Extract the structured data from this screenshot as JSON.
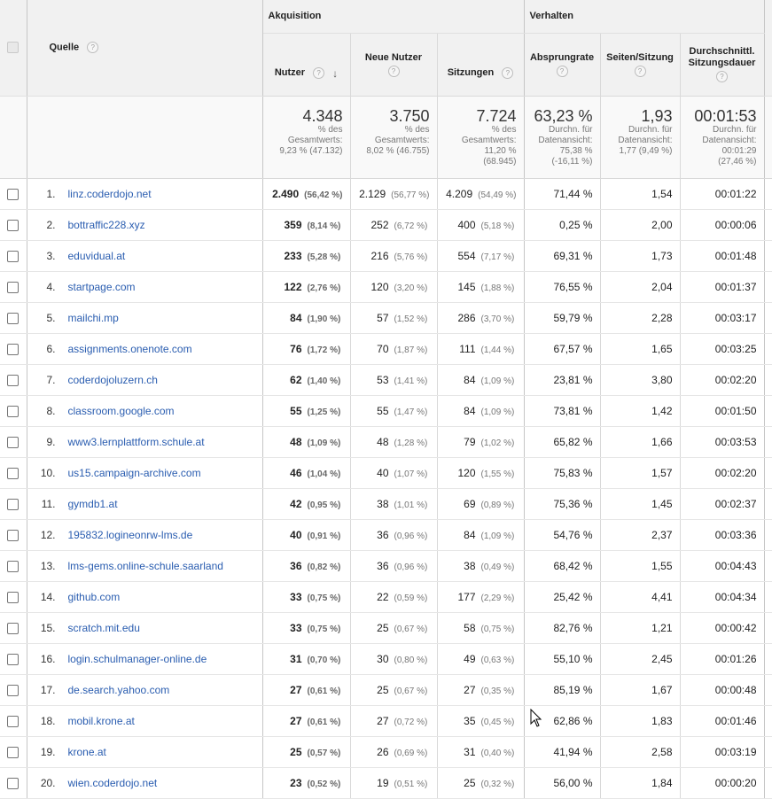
{
  "header": {
    "group_acquisition": "Akquisition",
    "group_behavior": "Verhalten",
    "col_source": "Quelle",
    "col_users": "Nutzer",
    "col_new_users": "Neue Nutzer",
    "col_sessions": "Sitzungen",
    "col_bounce": "Absprungrate",
    "col_pages": "Seiten/Sitzung",
    "col_duration_1": "Durchschnittl.",
    "col_duration_2": "Sitzungsdauer",
    "help_glyph": "?",
    "sort_glyph": "↓"
  },
  "totals": {
    "users": "4.348",
    "users_l1": "% des",
    "users_l2": "Gesamtwerts:",
    "users_l3": "9,23 % (47.132)",
    "new_users": "3.750",
    "new_users_l1": "% des",
    "new_users_l2": "Gesamtwerts:",
    "new_users_l3": "8,02 % (46.755)",
    "sessions": "7.724",
    "sessions_l1": "% des",
    "sessions_l2": "Gesamtwerts:",
    "sessions_l3": "11,20 %",
    "sessions_l4": "(68.945)",
    "bounce": "63,23 %",
    "bounce_l1": "Durchn. für",
    "bounce_l2": "Datenansicht:",
    "bounce_l3": "75,38 %",
    "bounce_l4": "(-16,11 %)",
    "pages": "1,93",
    "pages_l1": "Durchn. für",
    "pages_l2": "Datenansicht:",
    "pages_l3": "1,77 (9,49 %)",
    "duration": "00:01:53",
    "duration_l1": "Durchn. für",
    "duration_l2": "Datenansicht:",
    "duration_l3": "00:01:29",
    "duration_l4": "(27,46 %)"
  },
  "rows": [
    {
      "idx": "1.",
      "source": "linz.coderdojo.net",
      "users": "2.490",
      "users_pct": "(56,42 %)",
      "new_users": "2.129",
      "new_users_pct": "(56,77 %)",
      "sessions": "4.209",
      "sessions_pct": "(54,49 %)",
      "bounce": "71,44 %",
      "pages": "1,54",
      "duration": "00:01:22"
    },
    {
      "idx": "2.",
      "source": "bottraffic228.xyz",
      "users": "359",
      "users_pct": "(8,14 %)",
      "new_users": "252",
      "new_users_pct": "(6,72 %)",
      "sessions": "400",
      "sessions_pct": "(5,18 %)",
      "bounce": "0,25 %",
      "pages": "2,00",
      "duration": "00:00:06"
    },
    {
      "idx": "3.",
      "source": "eduvidual.at",
      "users": "233",
      "users_pct": "(5,28 %)",
      "new_users": "216",
      "new_users_pct": "(5,76 %)",
      "sessions": "554",
      "sessions_pct": "(7,17 %)",
      "bounce": "69,31 %",
      "pages": "1,73",
      "duration": "00:01:48"
    },
    {
      "idx": "4.",
      "source": "startpage.com",
      "users": "122",
      "users_pct": "(2,76 %)",
      "new_users": "120",
      "new_users_pct": "(3,20 %)",
      "sessions": "145",
      "sessions_pct": "(1,88 %)",
      "bounce": "76,55 %",
      "pages": "2,04",
      "duration": "00:01:37"
    },
    {
      "idx": "5.",
      "source": "mailchi.mp",
      "users": "84",
      "users_pct": "(1,90 %)",
      "new_users": "57",
      "new_users_pct": "(1,52 %)",
      "sessions": "286",
      "sessions_pct": "(3,70 %)",
      "bounce": "59,79 %",
      "pages": "2,28",
      "duration": "00:03:17"
    },
    {
      "idx": "6.",
      "source": "assignments.onenote.com",
      "users": "76",
      "users_pct": "(1,72 %)",
      "new_users": "70",
      "new_users_pct": "(1,87 %)",
      "sessions": "111",
      "sessions_pct": "(1,44 %)",
      "bounce": "67,57 %",
      "pages": "1,65",
      "duration": "00:03:25"
    },
    {
      "idx": "7.",
      "source": "coderdojoluzern.ch",
      "users": "62",
      "users_pct": "(1,40 %)",
      "new_users": "53",
      "new_users_pct": "(1,41 %)",
      "sessions": "84",
      "sessions_pct": "(1,09 %)",
      "bounce": "23,81 %",
      "pages": "3,80",
      "duration": "00:02:20"
    },
    {
      "idx": "8.",
      "source": "classroom.google.com",
      "users": "55",
      "users_pct": "(1,25 %)",
      "new_users": "55",
      "new_users_pct": "(1,47 %)",
      "sessions": "84",
      "sessions_pct": "(1,09 %)",
      "bounce": "73,81 %",
      "pages": "1,42",
      "duration": "00:01:50"
    },
    {
      "idx": "9.",
      "source": "www3.lernplattform.schule.at",
      "users": "48",
      "users_pct": "(1,09 %)",
      "new_users": "48",
      "new_users_pct": "(1,28 %)",
      "sessions": "79",
      "sessions_pct": "(1,02 %)",
      "bounce": "65,82 %",
      "pages": "1,66",
      "duration": "00:03:53"
    },
    {
      "idx": "10.",
      "source": "us15.campaign-archive.com",
      "users": "46",
      "users_pct": "(1,04 %)",
      "new_users": "40",
      "new_users_pct": "(1,07 %)",
      "sessions": "120",
      "sessions_pct": "(1,55 %)",
      "bounce": "75,83 %",
      "pages": "1,57",
      "duration": "00:02:20"
    },
    {
      "idx": "11.",
      "source": "gymdb1.at",
      "users": "42",
      "users_pct": "(0,95 %)",
      "new_users": "38",
      "new_users_pct": "(1,01 %)",
      "sessions": "69",
      "sessions_pct": "(0,89 %)",
      "bounce": "75,36 %",
      "pages": "1,45",
      "duration": "00:02:37"
    },
    {
      "idx": "12.",
      "source": "195832.logineonrw-lms.de",
      "users": "40",
      "users_pct": "(0,91 %)",
      "new_users": "36",
      "new_users_pct": "(0,96 %)",
      "sessions": "84",
      "sessions_pct": "(1,09 %)",
      "bounce": "54,76 %",
      "pages": "2,37",
      "duration": "00:03:36"
    },
    {
      "idx": "13.",
      "source": "lms-gems.online-schule.saarland",
      "users": "36",
      "users_pct": "(0,82 %)",
      "new_users": "36",
      "new_users_pct": "(0,96 %)",
      "sessions": "38",
      "sessions_pct": "(0,49 %)",
      "bounce": "68,42 %",
      "pages": "1,55",
      "duration": "00:04:43"
    },
    {
      "idx": "14.",
      "source": "github.com",
      "users": "33",
      "users_pct": "(0,75 %)",
      "new_users": "22",
      "new_users_pct": "(0,59 %)",
      "sessions": "177",
      "sessions_pct": "(2,29 %)",
      "bounce": "25,42 %",
      "pages": "4,41",
      "duration": "00:04:34"
    },
    {
      "idx": "15.",
      "source": "scratch.mit.edu",
      "users": "33",
      "users_pct": "(0,75 %)",
      "new_users": "25",
      "new_users_pct": "(0,67 %)",
      "sessions": "58",
      "sessions_pct": "(0,75 %)",
      "bounce": "82,76 %",
      "pages": "1,21",
      "duration": "00:00:42"
    },
    {
      "idx": "16.",
      "source": "login.schulmanager-online.de",
      "users": "31",
      "users_pct": "(0,70 %)",
      "new_users": "30",
      "new_users_pct": "(0,80 %)",
      "sessions": "49",
      "sessions_pct": "(0,63 %)",
      "bounce": "55,10 %",
      "pages": "2,45",
      "duration": "00:01:26"
    },
    {
      "idx": "17.",
      "source": "de.search.yahoo.com",
      "users": "27",
      "users_pct": "(0,61 %)",
      "new_users": "25",
      "new_users_pct": "(0,67 %)",
      "sessions": "27",
      "sessions_pct": "(0,35 %)",
      "bounce": "85,19 %",
      "pages": "1,67",
      "duration": "00:00:48"
    },
    {
      "idx": "18.",
      "source": "mobil.krone.at",
      "users": "27",
      "users_pct": "(0,61 %)",
      "new_users": "27",
      "new_users_pct": "(0,72 %)",
      "sessions": "35",
      "sessions_pct": "(0,45 %)",
      "bounce": "62,86 %",
      "pages": "1,83",
      "duration": "00:01:46"
    },
    {
      "idx": "19.",
      "source": "krone.at",
      "users": "25",
      "users_pct": "(0,57 %)",
      "new_users": "26",
      "new_users_pct": "(0,69 %)",
      "sessions": "31",
      "sessions_pct": "(0,40 %)",
      "bounce": "41,94 %",
      "pages": "2,58",
      "duration": "00:03:19"
    },
    {
      "idx": "20.",
      "source": "wien.coderdojo.net",
      "users": "23",
      "users_pct": "(0,52 %)",
      "new_users": "19",
      "new_users_pct": "(0,51 %)",
      "sessions": "25",
      "sessions_pct": "(0,32 %)",
      "bounce": "56,00 %",
      "pages": "1,84",
      "duration": "00:00:20"
    }
  ]
}
